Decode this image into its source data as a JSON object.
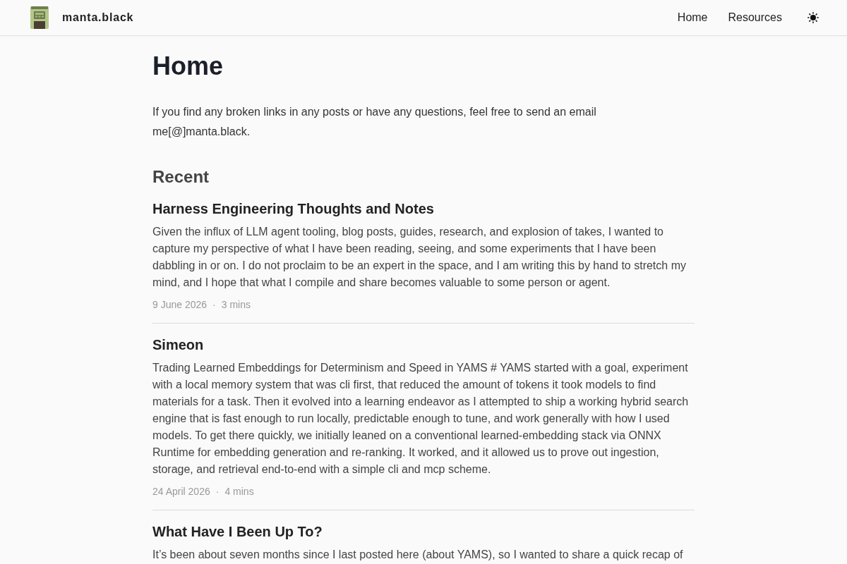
{
  "header": {
    "site_name": "manta.black",
    "nav": [
      {
        "label": "Home"
      },
      {
        "label": "Resources"
      }
    ]
  },
  "page": {
    "title": "Home",
    "intro": "If you find any broken links in any posts or have any questions, feel free to send an email me[@]manta.black."
  },
  "recent": {
    "heading": "Recent",
    "posts": [
      {
        "title": "Harness Engineering Thoughts and Notes",
        "summary": "Given the influx of LLM agent tooling, blog posts, guides, research, and explosion of takes, I wanted to capture my perspective of what I have been reading, seeing, and some experiments that I have been dabbling in or on. I do not proclaim to be an expert in the space, and I am writing this by hand to stretch my mind, and I hope that what I compile and share becomes valuable to some person or agent.",
        "date": "9 June 2026",
        "separator": "·",
        "read_time": "3 mins"
      },
      {
        "title": "Simeon",
        "summary": "Trading Learned Embeddings for Determinism and Speed in YAMS # YAMS started with a goal, experiment with a local memory system that was cli first, that reduced the amount of tokens it took models to find materials for a task. Then it evolved into a learning endeavor as I attempted to ship a working hybrid search engine that is fast enough to run locally, predictable enough to tune, and work generally with how I used models. To get there quickly, we initially leaned on a conventional learned-embedding stack via ONNX Runtime for embedding generation and re-ranking. It worked, and it allowed us to prove out ingestion, storage, and retrieval end-to-end with a simple cli and mcp scheme.",
        "date": "24 April 2026",
        "separator": "·",
        "read_time": "4 mins"
      },
      {
        "title": "What Have I Been Up To?",
        "summary": "It’s been about seven months since I last posted here (about YAMS), so I wanted to share a quick recap of"
      }
    ]
  }
}
